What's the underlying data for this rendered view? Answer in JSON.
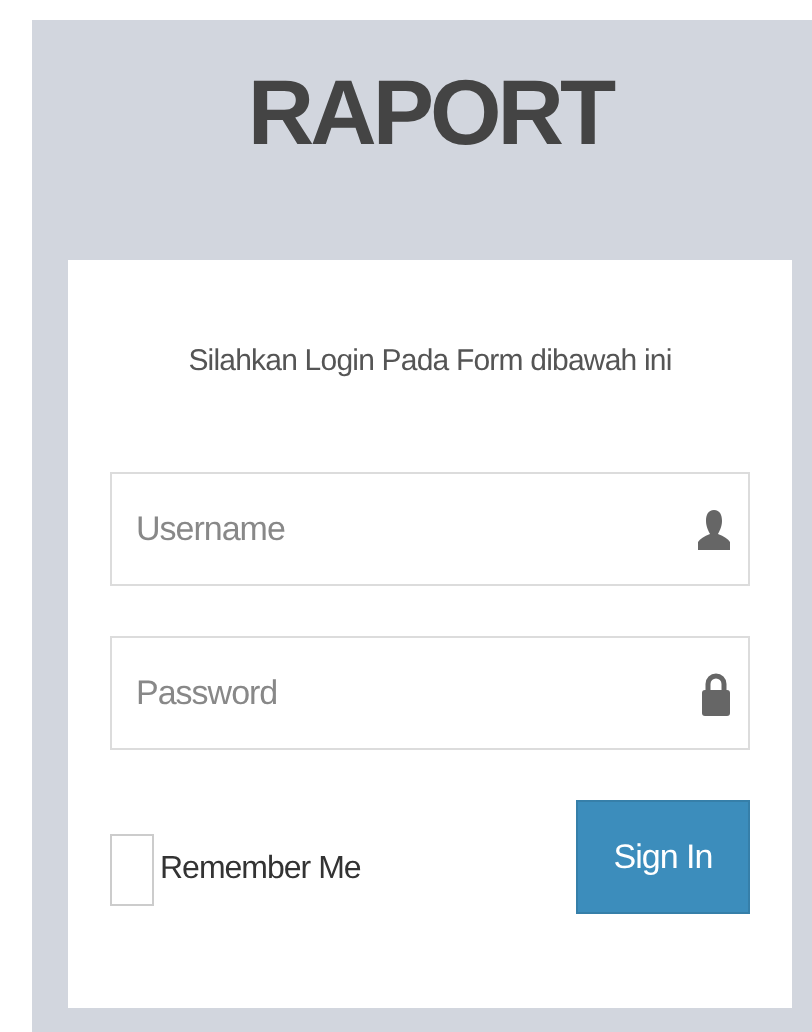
{
  "title": "RAPORT",
  "card": {
    "message": "Silahkan Login Pada Form dibawah ini",
    "fields": [
      {
        "kind": "user",
        "placeholder": "Username"
      },
      {
        "kind": "lock",
        "placeholder": "Password"
      }
    ],
    "remember": {
      "label": "Remember Me",
      "checked": false
    },
    "button": "Sign In"
  }
}
